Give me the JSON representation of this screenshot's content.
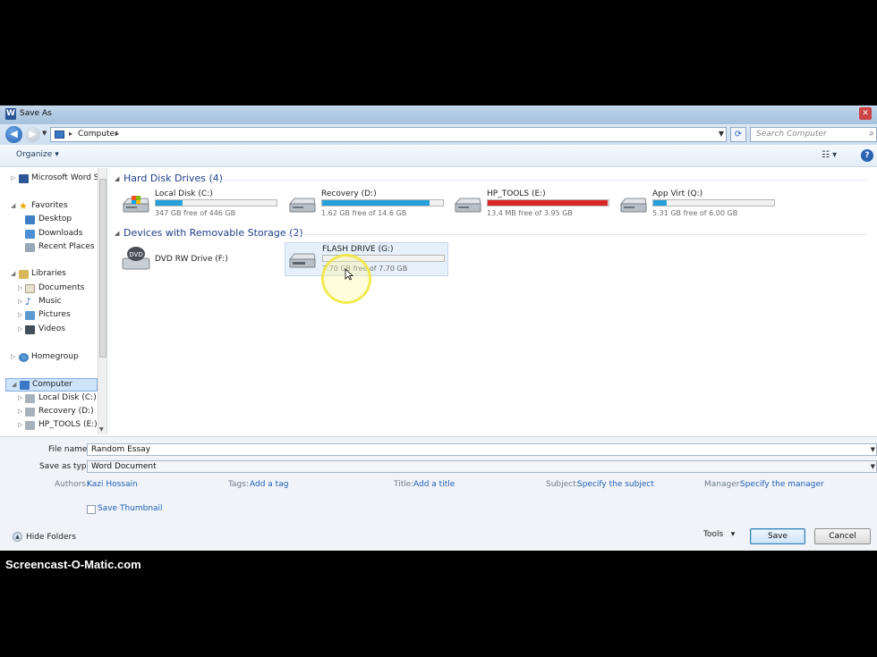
{
  "window": {
    "title": "Save As"
  },
  "address": {
    "path": "Computer",
    "search_placeholder": "Search Computer"
  },
  "toolbar": {
    "organize_label": "Organize"
  },
  "nav": {
    "top_item": "Microsoft Word Sta",
    "favorites": "Favorites",
    "desktop": "Desktop",
    "downloads": "Downloads",
    "recent_places": "Recent Places",
    "libraries": "Libraries",
    "documents": "Documents",
    "music": "Music",
    "pictures": "Pictures",
    "videos": "Videos",
    "homegroup": "Homegroup",
    "computer": "Computer",
    "local_disk": "Local Disk (C:)",
    "recovery": "Recovery (D:)",
    "hp_tools": "HP_TOOLS (E:)"
  },
  "groups": {
    "hard_disk": "Hard Disk Drives (4)",
    "removable": "Devices with Removable Storage (2)"
  },
  "drives": [
    {
      "name": "Local Disk (C:)",
      "free": "347 GB free of 446 GB",
      "used_fraction": 0.22,
      "color": "#26a0da"
    },
    {
      "name": "Recovery (D:)",
      "free": "1.62 GB free of 14.6 GB",
      "used_fraction": 0.89,
      "color": "#26a0da"
    },
    {
      "name": "HP_TOOLS (E:)",
      "free": "13.4 MB free of 3.95 GB",
      "used_fraction": 0.99,
      "color": "#da2626"
    },
    {
      "name": "App Virt (Q:)",
      "free": "5.31 GB free of 6.00 GB",
      "used_fraction": 0.11,
      "color": "#26a0da"
    }
  ],
  "removable": {
    "dvd_name": "DVD RW Drive (F:)",
    "dvd_label": "DVD",
    "flash_name": "FLASH DRIVE (G:)",
    "flash_free": "7.70 GB free of 7.70 GB",
    "flash_used_fraction": 0.0
  },
  "form": {
    "file_name_label": "File name:",
    "file_name_value": "Random Essay",
    "save_type_label": "Save as type:",
    "save_type_value": "Word Document",
    "authors_label": "Authors:",
    "authors_value": "Kazi Hossain",
    "tags_label": "Tags:",
    "tags_value": "Add a tag",
    "title_label": "Title:",
    "title_value": "Add a title",
    "subject_label": "Subject:",
    "subject_value": "Specify the subject",
    "manager_label": "Manager:",
    "manager_value": "Specify the manager",
    "thumbnail_label": "Save Thumbnail"
  },
  "footer": {
    "hide_folders": "Hide Folders",
    "tools": "Tools",
    "save": "Save",
    "cancel": "Cancel"
  },
  "watermark": "Screencast-O-Matic.com"
}
